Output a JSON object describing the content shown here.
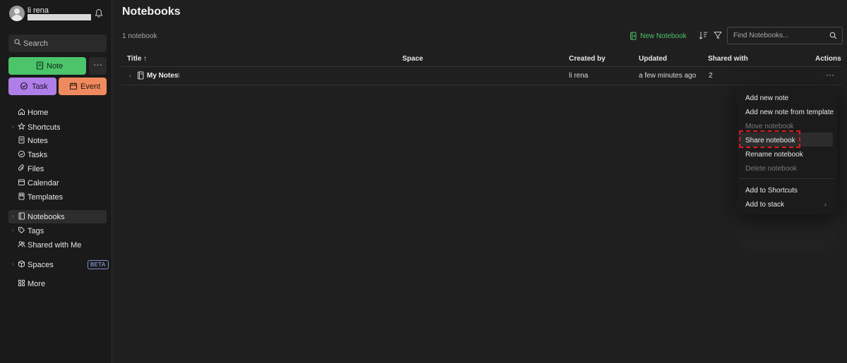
{
  "user": {
    "name": "li rena"
  },
  "sidebar": {
    "search_label": "Search",
    "note_label": "Note",
    "more_label": "···",
    "task_label": "Task",
    "event_label": "Event",
    "nav": [
      {
        "label": "Home",
        "icon": "home-icon"
      },
      {
        "label": "Shortcuts",
        "icon": "star-icon"
      },
      {
        "label": "Notes",
        "icon": "note-icon"
      },
      {
        "label": "Tasks",
        "icon": "task-check-icon"
      },
      {
        "label": "Files",
        "icon": "paperclip-icon"
      },
      {
        "label": "Calendar",
        "icon": "calendar-icon"
      },
      {
        "label": "Templates",
        "icon": "template-icon"
      },
      {
        "label": "Notebooks",
        "icon": "notebook-icon"
      },
      {
        "label": "Tags",
        "icon": "tag-icon"
      },
      {
        "label": "Shared with Me",
        "icon": "people-icon"
      },
      {
        "label": "Spaces",
        "icon": "cube-icon",
        "badge": "BETA"
      },
      {
        "label": "More",
        "icon": "grid-icon"
      }
    ]
  },
  "main": {
    "title": "Notebooks",
    "count_text": "1 notebook",
    "new_notebook_label": "New Notebook",
    "find_placeholder": "Find Notebooks...",
    "columns": [
      "Title ↑",
      "Space",
      "Created by",
      "Updated",
      "Shared with",
      "Actions"
    ],
    "rows": [
      {
        "title": "My Notes",
        "note_count": "4",
        "space": "",
        "created_by": "li rena",
        "updated": "a few minutes ago",
        "shared_with": "2",
        "actions": "···"
      }
    ]
  },
  "context_menu": {
    "items": [
      {
        "label": "Add new note",
        "enabled": true
      },
      {
        "label": "Add new note from template",
        "enabled": true
      },
      {
        "label": "Move notebook",
        "enabled": false
      },
      {
        "label": "Share notebook",
        "enabled": true,
        "hovered": true
      },
      {
        "label": "Rename notebook",
        "enabled": true
      },
      {
        "label": "Delete notebook",
        "enabled": false
      },
      {
        "label": "Add to Shortcuts",
        "enabled": true
      },
      {
        "label": "Add to stack",
        "enabled": true,
        "has_submenu": true
      }
    ]
  },
  "colors": {
    "accent_green": "#4bc46a",
    "task_purple": "#b07ee8",
    "event_orange": "#ef8a5f",
    "highlight_red": "#e0191f"
  }
}
